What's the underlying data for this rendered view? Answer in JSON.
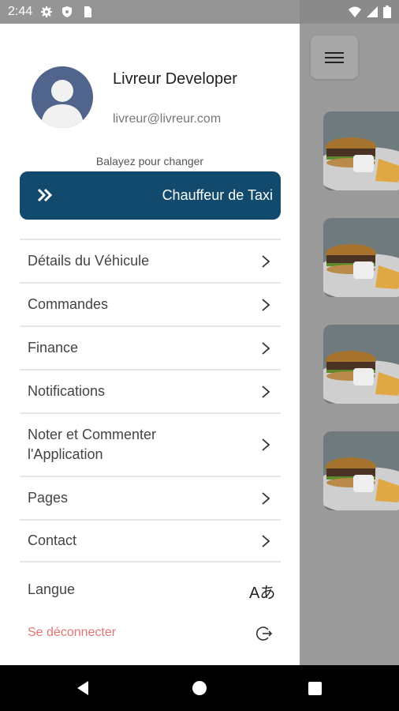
{
  "status_bar": {
    "time": "2:44",
    "left_icons": [
      "gear-icon",
      "shield-icon",
      "sim-icon"
    ],
    "right_icons": [
      "wifi-icon",
      "signal-icon",
      "battery-icon"
    ]
  },
  "drawer": {
    "user": {
      "name": "Livreur Developer",
      "email": "livreur@livreur.com"
    },
    "swipe_hint": "Balayez pour changer",
    "swipe_button": {
      "icon": "double-chevron-right-icon",
      "label": "Chauffeur de Taxi"
    },
    "menu_items": [
      {
        "label": "Détails du Véhicule"
      },
      {
        "label": "Commandes"
      },
      {
        "label": "Finance"
      },
      {
        "label": "Notifications"
      },
      {
        "label": "Noter et Commenter l'Application"
      },
      {
        "label": "Pages"
      },
      {
        "label": "Contact"
      }
    ],
    "language_label": "Langue",
    "language_icon_text": "Aあ",
    "logout_label": "Se déconnecter"
  },
  "colors": {
    "accent": "#114a6d",
    "logout": "#e57373",
    "avatar": "#51658c"
  }
}
